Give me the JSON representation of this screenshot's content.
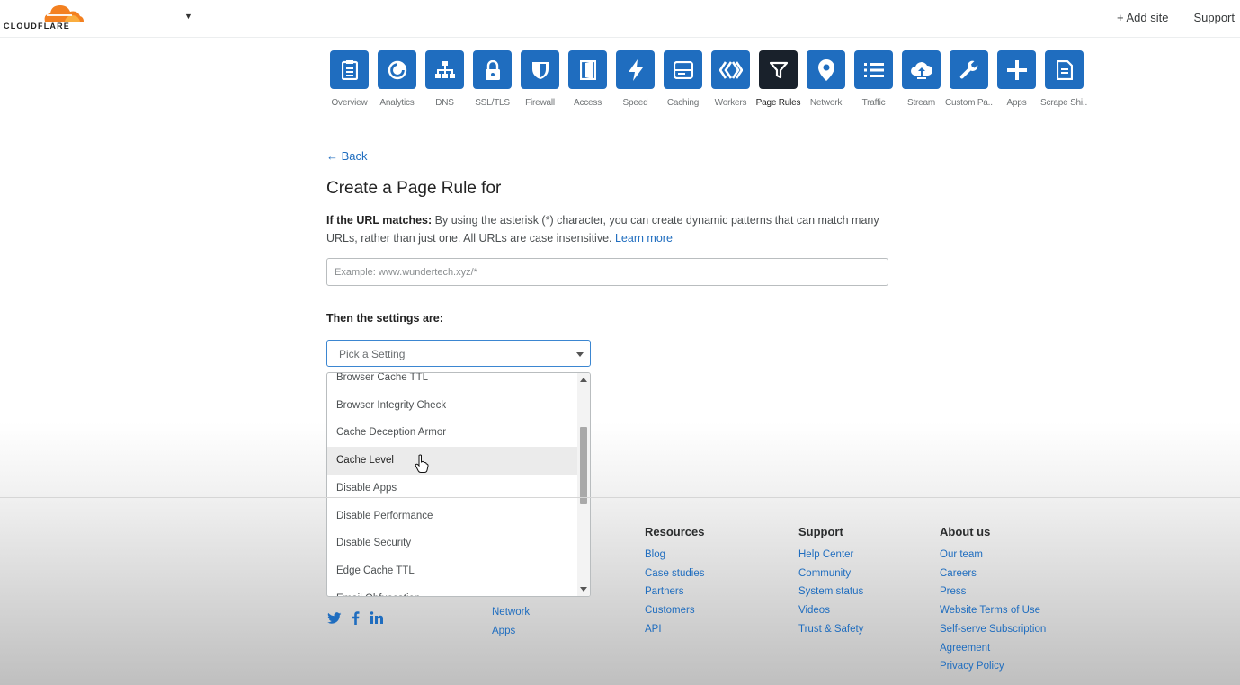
{
  "header": {
    "logo_text": "CLOUDFLARE",
    "add_site": "+ Add site",
    "support": "Support"
  },
  "apps": [
    {
      "label": "Overview",
      "icon": "clipboard-icon"
    },
    {
      "label": "Analytics",
      "icon": "pie-chart-icon"
    },
    {
      "label": "DNS",
      "icon": "sitemap-icon"
    },
    {
      "label": "SSL/TLS",
      "icon": "lock-icon"
    },
    {
      "label": "Firewall",
      "icon": "shield-icon"
    },
    {
      "label": "Access",
      "icon": "door-icon"
    },
    {
      "label": "Speed",
      "icon": "lightning-icon"
    },
    {
      "label": "Caching",
      "icon": "server-icon"
    },
    {
      "label": "Workers",
      "icon": "workers-icon"
    },
    {
      "label": "Page Rules",
      "icon": "filter-icon",
      "active": true
    },
    {
      "label": "Network",
      "icon": "location-pin-icon"
    },
    {
      "label": "Traffic",
      "icon": "list-icon"
    },
    {
      "label": "Stream",
      "icon": "cloud-upload-icon"
    },
    {
      "label": "Custom Pa...",
      "icon": "wrench-icon"
    },
    {
      "label": "Apps",
      "icon": "plus-icon"
    },
    {
      "label": "Scrape Shi...",
      "icon": "document-icon"
    }
  ],
  "main": {
    "back": "← Back",
    "title": "Create a Page Rule for",
    "desc_bold": "If the URL matches:",
    "desc_text": " By using the asterisk (*) character, you can create dynamic patterns that can match many URLs, rather than just one. All URLs are case insensitive. ",
    "learn_more": "Learn more",
    "url_placeholder": "Example: www.wundertech.xyz/*",
    "settings_label": "Then the settings are:",
    "select_placeholder": "Pick a Setting"
  },
  "dropdown": {
    "options": [
      "Browser Cache TTL",
      "Browser Integrity Check",
      "Cache Deception Armor",
      "Cache Level",
      "Disable Apps",
      "Disable Performance",
      "Disable Security",
      "Edge Cache TTL",
      "Email Obfuscation"
    ],
    "hovered": "Cache Level"
  },
  "footer": {
    "col1": [
      "Network",
      "Apps"
    ],
    "resources": {
      "title": "Resources",
      "links": [
        "Blog",
        "Case studies",
        "Partners",
        "Customers",
        "API"
      ]
    },
    "support": {
      "title": "Support",
      "links": [
        "Help Center",
        "Community",
        "System status",
        "Videos",
        "Trust & Safety"
      ]
    },
    "about": {
      "title": "About us",
      "links": [
        "Our team",
        "Careers",
        "Press",
        "Website Terms of Use",
        "Self-serve Subscription",
        "Agreement",
        "Privacy Policy"
      ]
    }
  },
  "colors": {
    "accent": "#1f6dbf",
    "active_tile": "#19212b",
    "brand_orange": "#f38020"
  }
}
